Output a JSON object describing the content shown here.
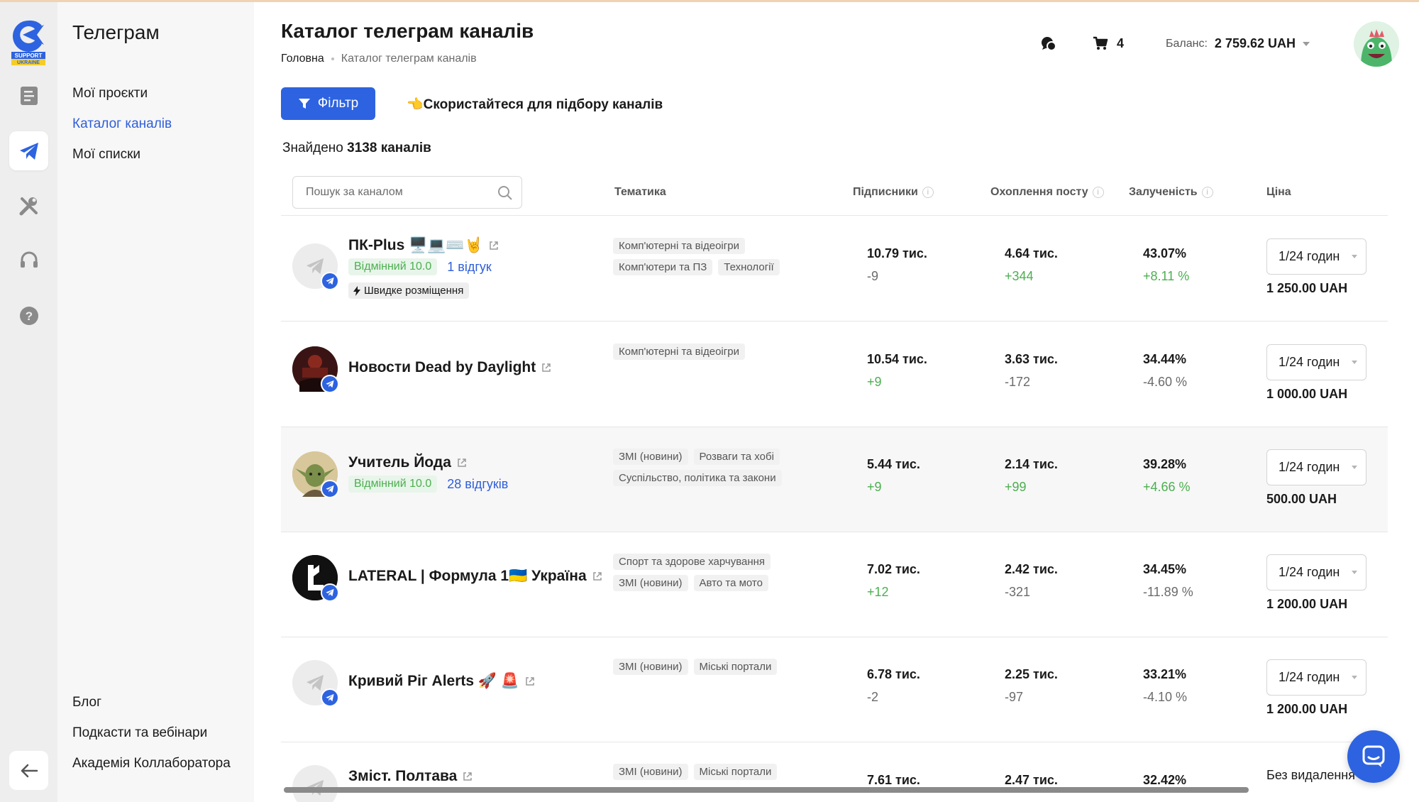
{
  "logo": {
    "text": "SUPPORT UKRAINE",
    "color": "#2d63e0"
  },
  "rail": {
    "items": [
      {
        "icon": "document-icon",
        "active": false
      },
      {
        "icon": "telegram-icon",
        "active": true
      },
      {
        "icon": "tools-icon",
        "active": false
      },
      {
        "icon": "headset-icon",
        "active": false
      },
      {
        "icon": "help-icon",
        "active": false
      }
    ],
    "back_icon": "arrow-left-icon"
  },
  "sidebar": {
    "title": "Телеграм",
    "items": [
      {
        "label": "Мої проєкти",
        "active": false
      },
      {
        "label": "Каталог каналів",
        "active": true
      },
      {
        "label": "Мої списки",
        "active": false
      }
    ],
    "footer": [
      {
        "label": "Блог"
      },
      {
        "label": "Подкасти та вебінари"
      },
      {
        "label": "Академія Коллаборатора"
      }
    ]
  },
  "header": {
    "title": "Каталог телеграм каналів",
    "breadcrumb": [
      "Головна",
      "Каталог телеграм каналів"
    ],
    "cart_count": "4",
    "balance_label": "Баланс:",
    "balance_value": "2 759.62 UAH"
  },
  "toolbar": {
    "filter_label": "Фільтр",
    "hint": "👈Скористайтеся для підбору каналів"
  },
  "found": {
    "prefix": "Знайдено",
    "count": "3138 каналів"
  },
  "table": {
    "search_placeholder": "Пошук за каналом",
    "columns": {
      "topic": "Тематика",
      "subscribers": "Підписники",
      "reach": "Охоплення посту",
      "engagement": "Залученість",
      "price": "Ціна"
    },
    "rows": [
      {
        "name": "ПК-Plus 🖥️💻⌨️🤘",
        "rating": "Відмінний 10.0",
        "reviews": "1 відгук",
        "fast": "Швидке розміщення",
        "tags": [
          "Комп'ютерні та відеоігри",
          "Комп'ютери та ПЗ",
          "Технології"
        ],
        "subscribers": "10.79 тис.",
        "subscribers_delta": "-9",
        "reach": "4.64 тис.",
        "reach_delta": "+344",
        "engagement": "43.07%",
        "engagement_delta": "+8.11 %",
        "format": "1/24 годин",
        "price": "1 250.00 UAH"
      },
      {
        "name": "Новости Dead by Daylight",
        "rating": "",
        "reviews": "",
        "fast": "",
        "tags": [
          "Комп'ютерні та відеоігри"
        ],
        "subscribers": "10.54 тис.",
        "subscribers_delta": "+9",
        "reach": "3.63 тис.",
        "reach_delta": "-172",
        "engagement": "34.44%",
        "engagement_delta": "-4.60 %",
        "format": "1/24 годин",
        "price": "1 000.00 UAH"
      },
      {
        "name": "Учитель Йода",
        "rating": "Відмінний 10.0",
        "reviews": "28 відгуків",
        "fast": "",
        "tags": [
          "ЗМІ (новини)",
          "Розваги та хобі",
          "Суспільство, політика та закони"
        ],
        "subscribers": "5.44 тис.",
        "subscribers_delta": "+9",
        "reach": "2.14 тис.",
        "reach_delta": "+99",
        "engagement": "39.28%",
        "engagement_delta": "+4.66 %",
        "format": "1/24 годин",
        "price": "500.00 UAH"
      },
      {
        "name": "LATERAL | Формула 1🇺🇦 Україна",
        "rating": "",
        "reviews": "",
        "fast": "",
        "tags": [
          "Спорт та здорове харчування",
          "ЗМІ (новини)",
          "Авто та мото"
        ],
        "subscribers": "7.02 тис.",
        "subscribers_delta": "+12",
        "reach": "2.42 тис.",
        "reach_delta": "-321",
        "engagement": "34.45%",
        "engagement_delta": "-11.89 %",
        "format": "1/24 годин",
        "price": "1 200.00 UAH"
      },
      {
        "name": "Кривий Ріг Alerts 🚀 🚨",
        "rating": "",
        "reviews": "",
        "fast": "",
        "tags": [
          "ЗМІ (новини)",
          "Міські портали"
        ],
        "subscribers": "6.78 тис.",
        "subscribers_delta": "-2",
        "reach": "2.25 тис.",
        "reach_delta": "-97",
        "engagement": "33.21%",
        "engagement_delta": "-4.10 %",
        "format": "1/24 годин",
        "price": "1 200.00 UAH"
      },
      {
        "name": "Зміст. Полтава",
        "rating": "",
        "reviews": "",
        "fast": "",
        "tags": [
          "ЗМІ (новини)",
          "Міські портали"
        ],
        "subscribers": "7.61 тис.",
        "subscribers_delta": "",
        "reach": "2.47 тис.",
        "reach_delta": "",
        "engagement": "32.42%",
        "engagement_delta": "",
        "format": "Без видалення",
        "price": ""
      }
    ]
  },
  "colors": {
    "accent": "#2d63e0",
    "positive": "#4caf50",
    "neutral": "#6b6b6b"
  },
  "chat_widget_icon": "chat-bubble-icon"
}
